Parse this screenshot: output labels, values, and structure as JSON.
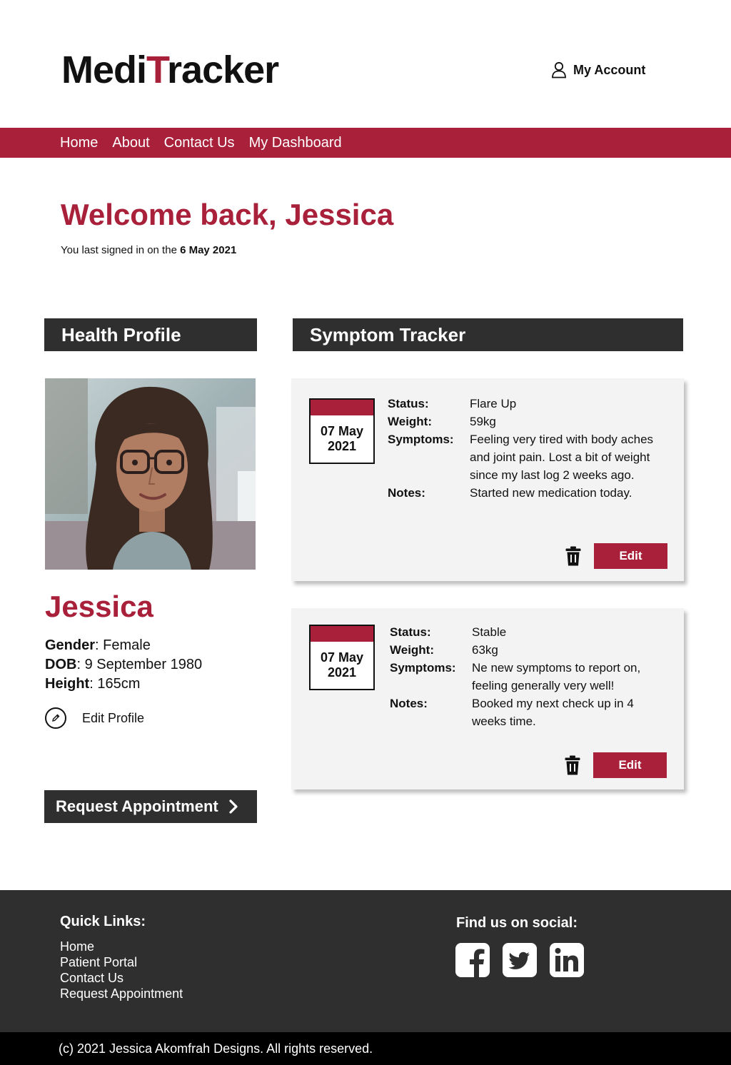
{
  "brand": {
    "prefix": "Medi",
    "accent_letter": "T",
    "suffix": "racker",
    "accent_color": "#a9203a"
  },
  "account": {
    "label": "My Account",
    "icon": "user-icon"
  },
  "nav": {
    "items": [
      "Home",
      "About",
      "Contact Us",
      "My Dashboard"
    ]
  },
  "welcome": {
    "heading": "Welcome back, Jessica",
    "last_signed_prefix": "You last signed in on the ",
    "last_signed_date": "6 May 2021"
  },
  "health_profile": {
    "title": "Health Profile",
    "name": "Jessica",
    "gender_label": "Gender",
    "gender": ": Female",
    "dob_label": "DOB",
    "dob": ": 9 September 1980",
    "height_label": "Height",
    "height": ": 165cm",
    "edit_label": "Edit Profile",
    "edit_icon": "pencil-icon",
    "request_label": "Request Appointment"
  },
  "symptom_tracker": {
    "title": "Symptom Tracker",
    "labels": {
      "status": "Status:",
      "weight": "Weight:",
      "symptoms": "Symptoms:",
      "notes": "Notes:"
    },
    "edit_label": "Edit",
    "entries": [
      {
        "date_line1": "07 May",
        "date_line2": "2021",
        "status": "Flare Up",
        "weight": "59kg",
        "symptoms": "Feeling very tired with body aches and joint pain. Lost a bit of weight since my last log 2 weeks ago.",
        "notes": "Started new medication today."
      },
      {
        "date_line1": "07 May",
        "date_line2": "2021",
        "status": "Stable",
        "weight": "63kg",
        "symptoms": "Ne new symptoms to report on, feeling generally very well!",
        "notes": "Booked my next check up in 4 weeks time."
      }
    ]
  },
  "footer": {
    "quick_links_title": "Quick Links:",
    "quick_links": [
      "Home",
      "Patient Portal",
      "Contact Us",
      "Request Appointment"
    ],
    "social_title": "Find us on social:",
    "social_icons": [
      "facebook-icon",
      "twitter-icon",
      "linkedin-icon"
    ],
    "copyright": "(c) 2021 Jessica Akomfrah Designs. All rights reserved."
  },
  "colors": {
    "accent": "#a9203a",
    "dark": "#2f2f2f",
    "card": "#f3f3f3"
  }
}
